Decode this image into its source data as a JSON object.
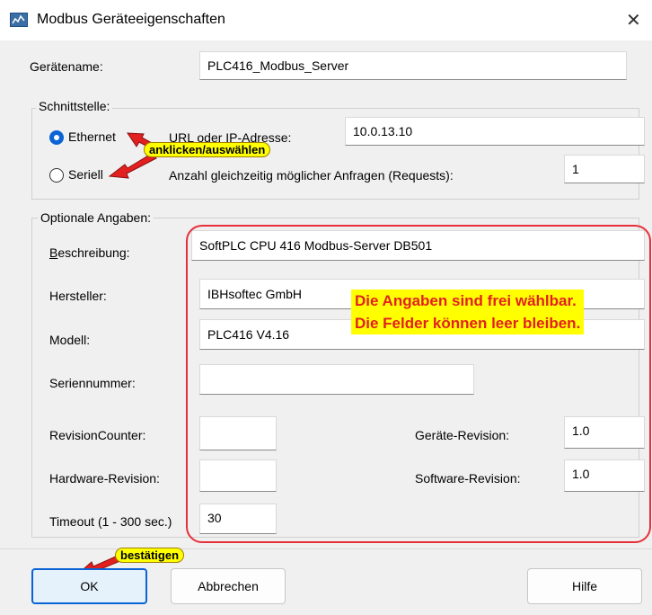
{
  "window": {
    "title": "Modbus Geräteeigenschaften",
    "close_glyph": "✕"
  },
  "device_name": {
    "label": "Gerätename:",
    "value": "PLC416_Modbus_Server"
  },
  "interface": {
    "legend": "Schnittstelle:",
    "ethernet_label": "Ethernet",
    "ethernet_selected": true,
    "serial_label": "Seriell",
    "url_label": "URL oder IP-Adresse:",
    "url_value": "10.0.13.10",
    "requests_label": "Anzahl gleichzeitig möglicher Anfragen (Requests):",
    "requests_value": "1"
  },
  "optional": {
    "legend": "Optionale Angaben:",
    "description_label": "Beschreibung:",
    "description_value": "SoftPLC CPU 416 Modbus-Server DB501",
    "manufacturer_label": "Hersteller:",
    "manufacturer_value": "IBHsoftec GmbH",
    "model_label": "Modell:",
    "model_value": "PLC416 V4.16",
    "serial_no_label": "Seriennummer:",
    "serial_no_value": "",
    "revision_counter_label": "RevisionCounter:",
    "revision_counter_value": "",
    "device_revision_label": "Geräte-Revision:",
    "device_revision_value": "1.0",
    "hardware_revision_label": "Hardware-Revision:",
    "hardware_revision_value": "",
    "software_revision_label": "Software-Revision:",
    "software_revision_value": "1.0",
    "timeout_label": "Timeout (1 - 300 sec.)",
    "timeout_value": "30"
  },
  "annotations": {
    "select_callout": "anklicken/auswählen",
    "info_line1": "Die Angaben sind frei wählbar.",
    "info_line2": "Die Felder können leer bleiben.",
    "confirm_callout": "bestätigen",
    "highlight_color": "#ffff00",
    "annotation_red": "#e32020"
  },
  "buttons": {
    "ok": "OK",
    "cancel": "Abbrechen",
    "help": "Hilfe"
  },
  "colors": {
    "accent": "#0a64d6",
    "dialog_bg": "#f0f0f0"
  },
  "icons": {
    "app": "modbus-app-icon",
    "close": "close-icon"
  }
}
